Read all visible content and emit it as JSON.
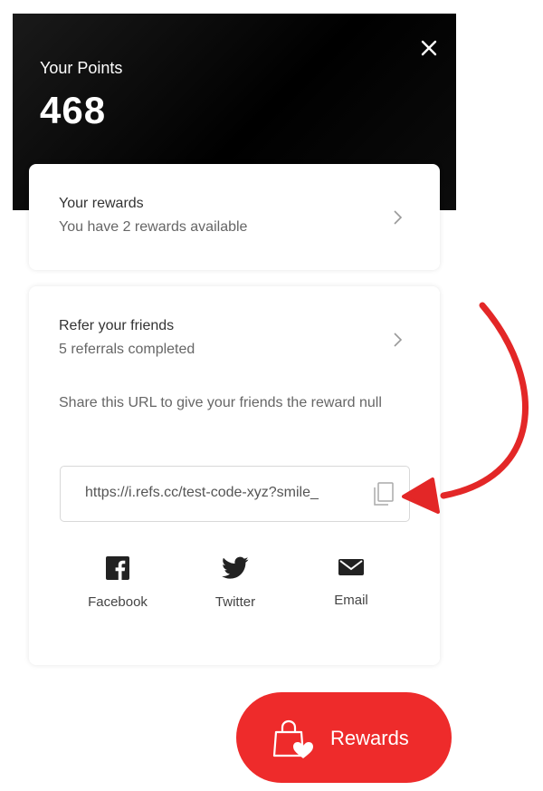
{
  "header": {
    "title": "Your Points",
    "points": "468"
  },
  "rewards_card": {
    "title": "Your rewards",
    "subtitle": "You have 2 rewards available"
  },
  "refer_card": {
    "title": "Refer your friends",
    "subtitle": "5 referrals completed",
    "share_text": "Share this URL to give your friends the reward null",
    "url": "https://i.refs.cc/test-code-xyz?smile_",
    "share_buttons": [
      {
        "label": "Facebook",
        "icon": "facebook-icon"
      },
      {
        "label": "Twitter",
        "icon": "twitter-icon"
      },
      {
        "label": "Email",
        "icon": "email-icon"
      }
    ]
  },
  "fab": {
    "label": "Rewards",
    "icon": "shopping-bag-heart-icon"
  },
  "colors": {
    "header_bg": "#000000",
    "accent_red": "#ee2b2b",
    "arrow_red": "#e32727"
  }
}
